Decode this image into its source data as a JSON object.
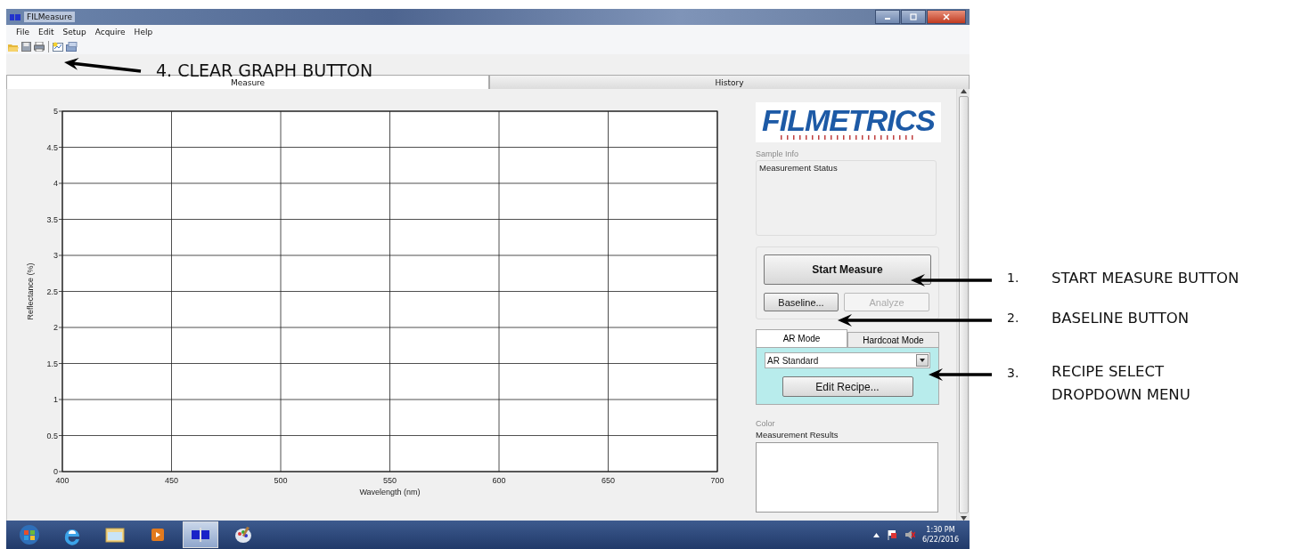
{
  "window": {
    "title": "FILMeasure"
  },
  "menu": [
    {
      "label": "File"
    },
    {
      "label": "Edit"
    },
    {
      "label": "Setup"
    },
    {
      "label": "Acquire"
    },
    {
      "label": "Help"
    }
  ],
  "tabs": [
    {
      "label": "Measure",
      "selected": true
    },
    {
      "label": "History",
      "selected": false
    }
  ],
  "graph": {
    "chart_data": {
      "type": "line",
      "grid": true,
      "xlabel": "Wavelength (nm)",
      "ylabel": "Reflectance (%)",
      "xlim": [
        400,
        700
      ],
      "ylim": [
        0,
        5
      ],
      "xticks": [
        400,
        450,
        500,
        550,
        600,
        650,
        700
      ],
      "yticks": [
        0,
        0.5,
        1,
        1.5,
        2,
        2.5,
        3,
        3.5,
        4,
        4.5,
        5
      ]
    }
  },
  "side_panel": {
    "logo": "FILMETRICS",
    "sample_info_legend": "Sample Info",
    "status_label": "Measurement Status",
    "start_button": "Start Measure",
    "baseline_button": {
      "label": "Baseline...",
      "disabled": false
    },
    "analyze_button": {
      "label": "Analyze",
      "disabled": true
    },
    "mode_tabs": [
      {
        "label": "AR Mode",
        "selected": true
      },
      {
        "label": "Hardcoat Mode",
        "selected": false
      }
    ],
    "recipe": {
      "value": "AR Standard"
    },
    "edit_recipe_button": "Edit Recipe...",
    "color_legend": "Color",
    "results_label": "Measurement Results"
  },
  "taskbar": {
    "time": "1:30 PM",
    "date": "6/22/2016"
  },
  "callouts": [
    {
      "label": "4. CLEAR GRAPH BUTTON"
    },
    {
      "number": "1.",
      "label": "START MEASURE BUTTON"
    },
    {
      "number": "2.",
      "label": "BASELINE BUTTON"
    },
    {
      "number": "3.",
      "label": "RECIPE SELECT DROPDOWN MENU"
    }
  ]
}
